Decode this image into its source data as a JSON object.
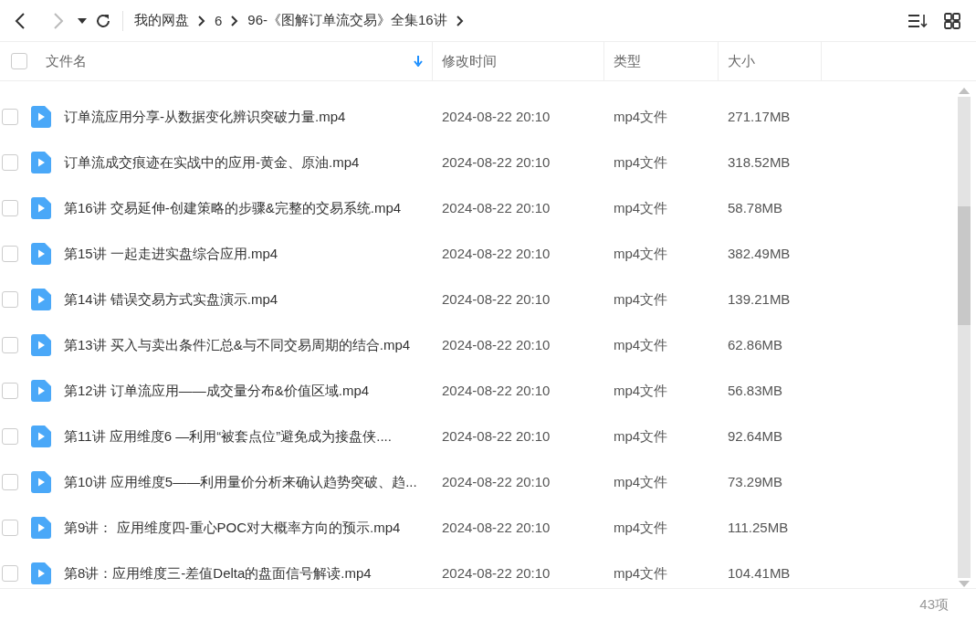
{
  "toolbar": {
    "breadcrumbs": [
      {
        "label": "我的网盘"
      },
      {
        "label": "6"
      },
      {
        "label": "96-《图解订单流交易》全集16讲"
      }
    ]
  },
  "table": {
    "select_all": {
      "checked": false
    },
    "columns": [
      {
        "label": "文件名",
        "sorted": true
      },
      {
        "label": "修改时间",
        "sorted": false
      },
      {
        "label": "类型",
        "sorted": false
      },
      {
        "label": "大小",
        "sorted": false
      }
    ],
    "rows": [
      {
        "name": "订单流应用分享-从数据变化辨识突破力量.mp4",
        "modified": "2024-08-22 20:10",
        "type": "mp4文件",
        "size": "271.17MB",
        "checked": false
      },
      {
        "name": "订单流成交痕迹在实战中的应用-黄金、原油.mp4",
        "modified": "2024-08-22 20:10",
        "type": "mp4文件",
        "size": "318.52MB",
        "checked": false
      },
      {
        "name": "第16讲  交易延伸-创建策略的步骤&完整的交易系统.mp4",
        "modified": "2024-08-22 20:10",
        "type": "mp4文件",
        "size": "58.78MB",
        "checked": false
      },
      {
        "name": "第15讲 一起走进实盘综合应用.mp4",
        "modified": "2024-08-22 20:10",
        "type": "mp4文件",
        "size": "382.49MB",
        "checked": false
      },
      {
        "name": "第14讲  错误交易方式实盘演示.mp4",
        "modified": "2024-08-22 20:10",
        "type": "mp4文件",
        "size": "139.21MB",
        "checked": false
      },
      {
        "name": "第13讲 买入与卖出条件汇总&与不同交易周期的结合.mp4",
        "modified": "2024-08-22 20:10",
        "type": "mp4文件",
        "size": "62.86MB",
        "checked": false
      },
      {
        "name": "第12讲 订单流应用——成交量分布&价值区域.mp4",
        "modified": "2024-08-22 20:10",
        "type": "mp4文件",
        "size": "56.83MB",
        "checked": false
      },
      {
        "name": "第11讲 应用维度6 —利用“被套点位”避免成为接盘侠....",
        "modified": "2024-08-22 20:10",
        "type": "mp4文件",
        "size": "92.64MB",
        "checked": false
      },
      {
        "name": "第10讲 应用维度5——利用量价分析来确认趋势突破、趋...",
        "modified": "2024-08-22 20:10",
        "type": "mp4文件",
        "size": "73.29MB",
        "checked": false
      },
      {
        "name": "第9讲：  应用维度四-重心POC对大概率方向的预示.mp4",
        "modified": "2024-08-22 20:10",
        "type": "mp4文件",
        "size": "111.25MB",
        "checked": false
      },
      {
        "name": "第8讲：应用维度三-差值Delta的盘面信号解读.mp4",
        "modified": "2024-08-22 20:10",
        "type": "mp4文件",
        "size": "104.41MB",
        "checked": false
      }
    ]
  },
  "status_bar": {
    "count": "43项"
  }
}
